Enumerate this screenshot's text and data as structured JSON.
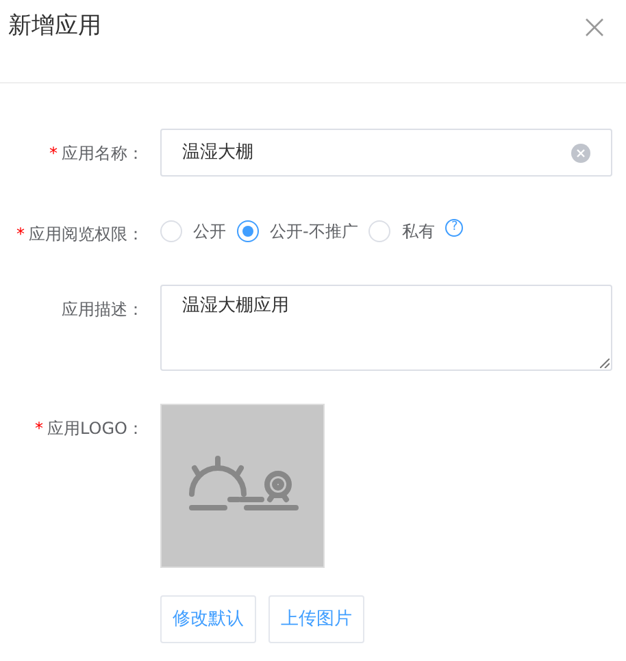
{
  "dialog": {
    "title": "新增应用"
  },
  "fields": [
    {
      "kind": "text",
      "label": "应用名称：",
      "required_mark": "*",
      "value": "温湿大棚"
    },
    {
      "kind": "radio",
      "label": "应用阅览权限：",
      "required_mark": "*",
      "options": [
        {
          "label": "公开",
          "selected": false
        },
        {
          "label": "公开-不推广",
          "selected": true
        },
        {
          "label": "私有",
          "selected": false
        }
      ],
      "help": "?"
    },
    {
      "kind": "textarea",
      "label": "应用描述：",
      "value": "温湿大棚应用"
    },
    {
      "kind": "logo",
      "label": "应用LOGO：",
      "required_mark": "*",
      "buttons": [
        "修改默认",
        "上传图片"
      ]
    }
  ]
}
